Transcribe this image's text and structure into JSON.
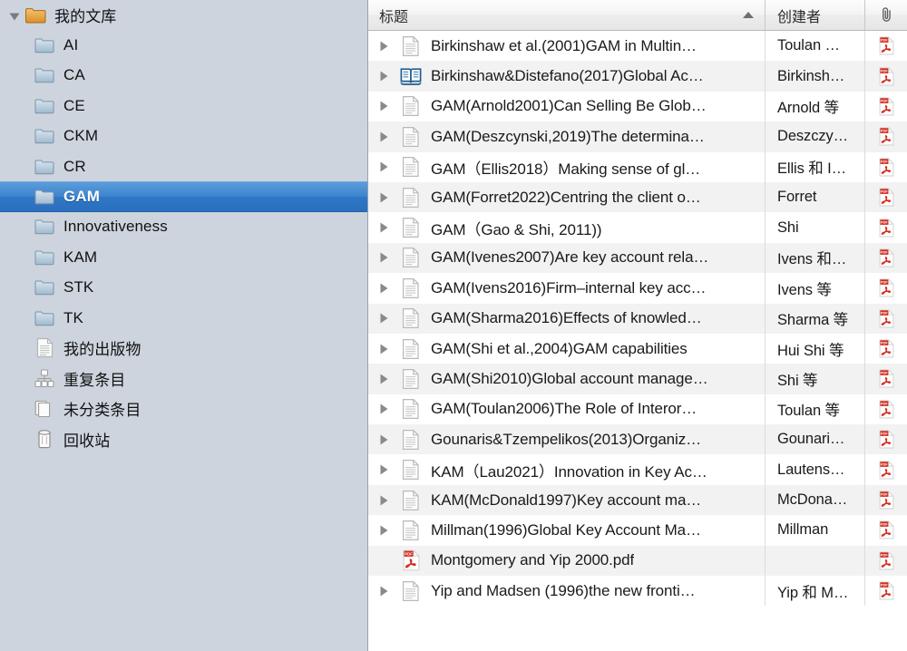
{
  "sidebar": {
    "root": {
      "label": "我的文库",
      "icon": "library-folder-icon",
      "expanded": true
    },
    "items": [
      {
        "label": "AI",
        "icon": "folder-icon",
        "selected": false
      },
      {
        "label": "CA",
        "icon": "folder-icon",
        "selected": false
      },
      {
        "label": "CE",
        "icon": "folder-icon",
        "selected": false
      },
      {
        "label": "CKM",
        "icon": "folder-icon",
        "selected": false
      },
      {
        "label": "CR",
        "icon": "folder-icon",
        "selected": false
      },
      {
        "label": "GAM",
        "icon": "folder-icon",
        "selected": true
      },
      {
        "label": "Innovativeness",
        "icon": "folder-icon",
        "selected": false
      },
      {
        "label": "KAM",
        "icon": "folder-icon",
        "selected": false
      },
      {
        "label": "STK",
        "icon": "folder-icon",
        "selected": false
      },
      {
        "label": "TK",
        "icon": "folder-icon",
        "selected": false
      },
      {
        "label": "我的出版物",
        "icon": "document-icon",
        "selected": false
      },
      {
        "label": "重复条目",
        "icon": "duplicates-icon",
        "selected": false
      },
      {
        "label": "未分类条目",
        "icon": "unfiled-icon",
        "selected": false
      },
      {
        "label": "回收站",
        "icon": "trash-icon",
        "selected": false
      }
    ]
  },
  "items_pane": {
    "columns": [
      {
        "key": "title",
        "label": "标题",
        "sort": "asc"
      },
      {
        "key": "creator",
        "label": "创建者",
        "sort": null
      },
      {
        "key": "attachment",
        "label": "",
        "icon": "paperclip-icon"
      }
    ],
    "rows": [
      {
        "title": "Birkinshaw et al.(2001)GAM in Multin…",
        "creator": "Toulan …",
        "icon": "journal-article-icon",
        "twisty": true,
        "attachment": "pdf-icon"
      },
      {
        "title": "Birkinshaw&Distefano(2017)Global Ac…",
        "creator": "Birkinsh…",
        "icon": "book-section-icon",
        "twisty": true,
        "attachment": "pdf-icon"
      },
      {
        "title": "GAM(Arnold2001)Can Selling Be Glob…",
        "creator": "Arnold 等",
        "icon": "journal-article-icon",
        "twisty": true,
        "attachment": "pdf-icon"
      },
      {
        "title": "GAM(Deszcynski,2019)The determina…",
        "creator": "Deszczy…",
        "icon": "journal-article-icon",
        "twisty": true,
        "attachment": "pdf-icon"
      },
      {
        "title": "GAM（Ellis2018）Making sense of gl…",
        "creator": "Ellis 和 I…",
        "icon": "journal-article-icon",
        "twisty": true,
        "attachment": "pdf-icon"
      },
      {
        "title": "GAM(Forret2022)Centring the client o…",
        "creator": "Forret",
        "icon": "journal-article-icon",
        "twisty": true,
        "attachment": "pdf-icon"
      },
      {
        "title": "GAM（Gao & Shi, 2011))",
        "creator": "Shi",
        "icon": "journal-article-icon",
        "twisty": true,
        "attachment": "pdf-icon"
      },
      {
        "title": "GAM(Ivenes2007)Are key account rela…",
        "creator": "Ivens 和…",
        "icon": "journal-article-icon",
        "twisty": true,
        "attachment": "pdf-icon"
      },
      {
        "title": "GAM(Ivens2016)Firm–internal key acc…",
        "creator": "Ivens 等",
        "icon": "journal-article-icon",
        "twisty": true,
        "attachment": "pdf-icon"
      },
      {
        "title": "GAM(Sharma2016)Effects of knowled…",
        "creator": "Sharma 等",
        "icon": "journal-article-icon",
        "twisty": true,
        "attachment": "pdf-icon"
      },
      {
        "title": "GAM(Shi et al.,2004)GAM capabilities",
        "creator": "Hui Shi 等",
        "icon": "journal-article-icon",
        "twisty": true,
        "attachment": "pdf-icon"
      },
      {
        "title": "GAM(Shi2010)Global account manage…",
        "creator": "Shi 等",
        "icon": "journal-article-icon",
        "twisty": true,
        "attachment": "pdf-icon"
      },
      {
        "title": "GAM(Toulan2006)The Role of Interor…",
        "creator": "Toulan 等",
        "icon": "journal-article-icon",
        "twisty": true,
        "attachment": "pdf-icon"
      },
      {
        "title": "Gounaris&Tzempelikos(2013)Organiz…",
        "creator": "Gounari…",
        "icon": "journal-article-icon",
        "twisty": true,
        "attachment": "pdf-icon"
      },
      {
        "title": "KAM（Lau2021）Innovation in Key Ac…",
        "creator": "Lautens…",
        "icon": "journal-article-icon",
        "twisty": true,
        "attachment": "pdf-icon"
      },
      {
        "title": "KAM(McDonald1997)Key account ma…",
        "creator": "McDona…",
        "icon": "journal-article-icon",
        "twisty": true,
        "attachment": "pdf-icon"
      },
      {
        "title": "Millman(1996)Global Key Account Ma…",
        "creator": "Millman",
        "icon": "journal-article-icon",
        "twisty": true,
        "attachment": "pdf-icon"
      },
      {
        "title": "Montgomery and Yip 2000.pdf",
        "creator": "",
        "icon": "pdf-icon",
        "twisty": false,
        "attachment": "pdf-icon"
      },
      {
        "title": "Yip and Madsen (1996)the new fronti…",
        "creator": "Yip 和 M…",
        "icon": "journal-article-icon",
        "twisty": true,
        "attachment": "pdf-icon"
      }
    ]
  },
  "colors": {
    "selection_blue": "#3d84ce",
    "sidebar_background": "#cdd4de",
    "row_alt": "#f2f2f2",
    "pdf_red": "#d42b1e",
    "folder_blue": "#b7cbdd",
    "library_orange": "#e8a33d"
  }
}
